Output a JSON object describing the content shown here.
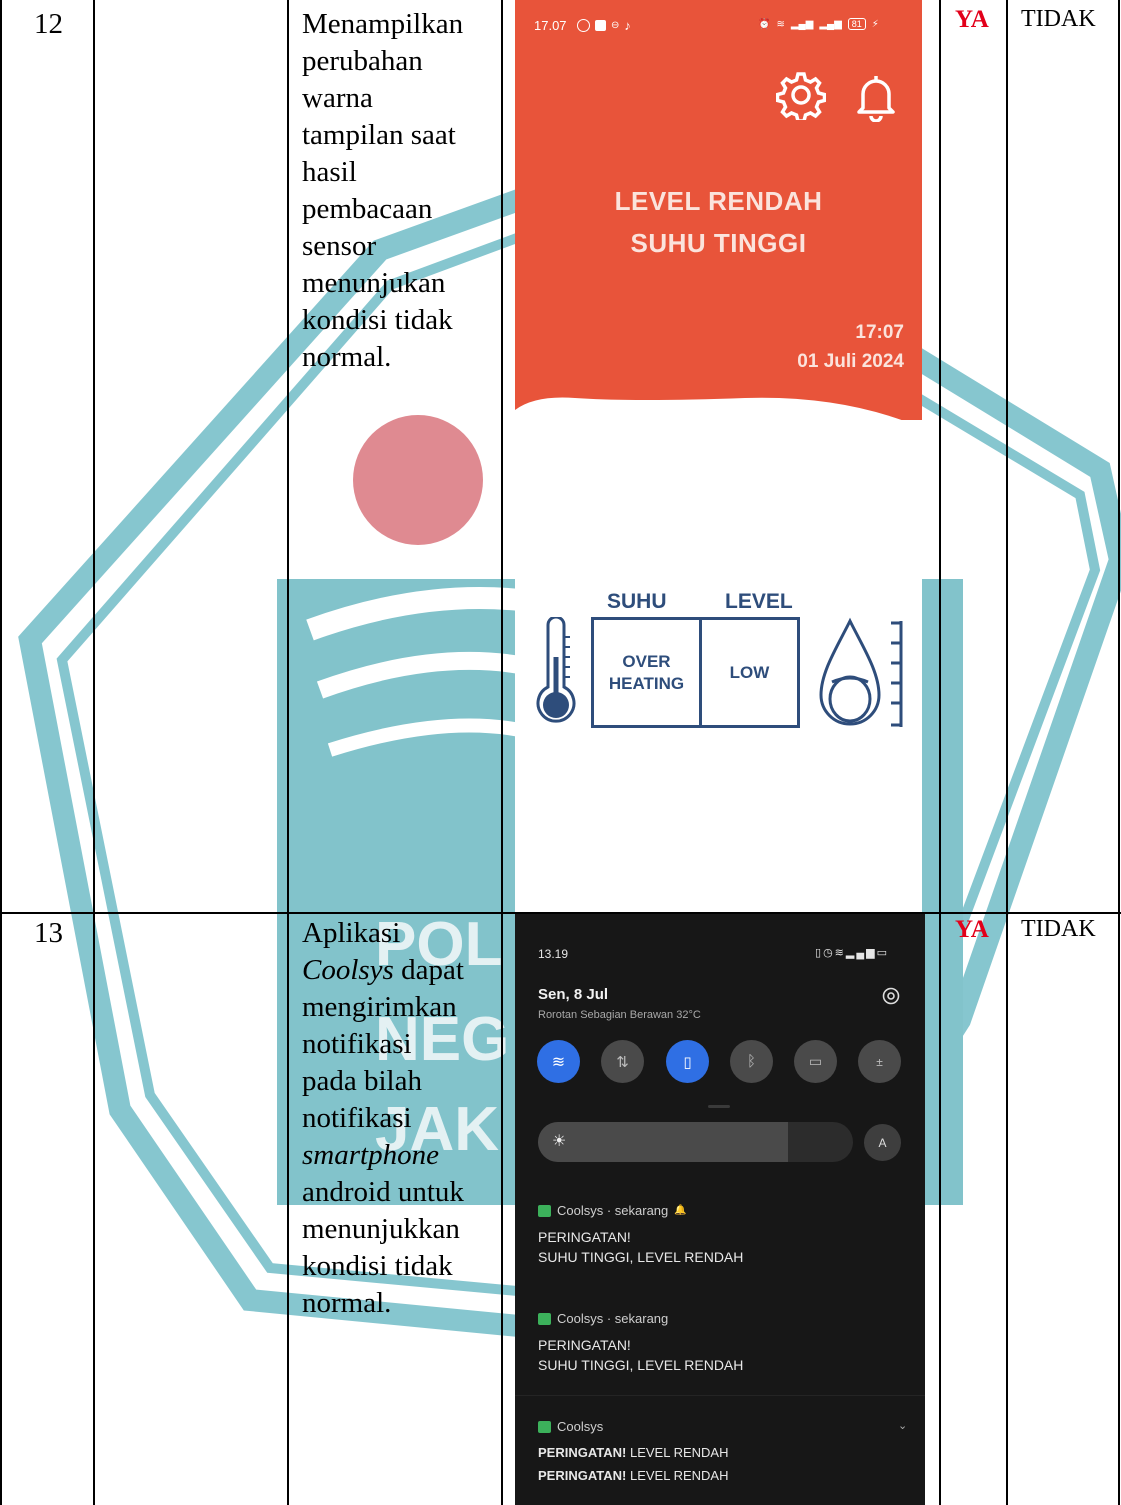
{
  "rows": [
    {
      "number": "12",
      "desc_line1": "Menampilkan",
      "desc_line2": "perubahan",
      "desc_line3": "warna",
      "desc_line4": "tampilan saat",
      "desc_line5": "hasil",
      "desc_line6": "pembacaan",
      "desc_line7": "sensor",
      "desc_line8": "menunjukan",
      "desc_line9": "kondisi tidak",
      "desc_line10": "normal.",
      "ya": "YA",
      "tidak": "TIDAK"
    },
    {
      "number": "13",
      "desc_line1": "Aplikasi",
      "desc_line2_italic": "Coolsys",
      "desc_line2_rest": " dapat",
      "desc_line3": "mengirimkan",
      "desc_line4": "notifikasi",
      "desc_line5": "pada bilah",
      "desc_line6": "notifikasi",
      "desc_line7_italic": "smartphone",
      "desc_line8": "android untuk",
      "desc_line9": "menunjukkan",
      "desc_line10": "kondisi tidak",
      "desc_line11": "normal.",
      "ya": "YA",
      "tidak": "TIDAK"
    }
  ],
  "app_screen": {
    "status_time": "17.07",
    "status_battery": "81",
    "alarm_line1": "LEVEL RENDAH",
    "alarm_line2": "SUHU TINGGI",
    "time": "17:07",
    "date": "01 Juli 2024",
    "suhu_label": "SUHU",
    "level_label": "LEVEL",
    "suhu_value_line1": "OVER",
    "suhu_value_line2": "HEATING",
    "level_value": "LOW",
    "colors": {
      "alarm_bg": "#e8543a",
      "gauge": "#2e4d7b"
    }
  },
  "notif_screen": {
    "status_time": "13.19",
    "date": "Sen, 8 Jul",
    "weather": "Rorotan Sebagian Berawan 32°C",
    "auto_brightness": "A",
    "notifications": [
      {
        "app": "Coolsys · sekarang",
        "title": "PERINGATAN!",
        "body": "SUHU TINGGI, LEVEL RENDAH"
      },
      {
        "app": "Coolsys · sekarang",
        "title": "PERINGATAN!",
        "body": "SUHU TINGGI, LEVEL RENDAH"
      }
    ],
    "group": {
      "app": "Coolsys",
      "line1_bold": "PERINGATAN!",
      "line1_rest": " LEVEL RENDAH",
      "line2_bold": "PERINGATAN!",
      "line2_rest": " LEVEL RENDAH"
    },
    "colors": {
      "bg": "#171717",
      "toggle_on": "#2f6fe4"
    }
  },
  "watermark": {
    "text_line1": "POL",
    "text_line2": "NEG",
    "text_line3": "JAK"
  }
}
